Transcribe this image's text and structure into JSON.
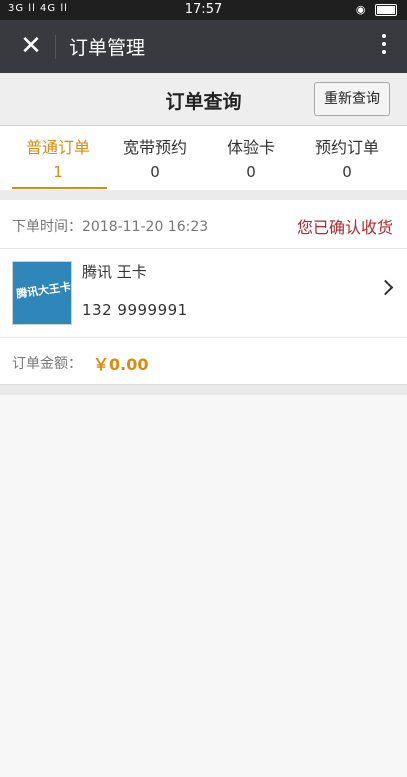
{
  "status_bar": {
    "signal": "3G ll 4G ll",
    "time": "17:57"
  },
  "app_bar": {
    "close_icon": "close-icon",
    "title": "订单管理",
    "more_icon": "more-vertical-icon"
  },
  "header": {
    "title": "订单查询",
    "requery_label": "重新查询"
  },
  "tabs": [
    {
      "label": "普通订单",
      "count": "1",
      "active": true
    },
    {
      "label": "宽带预约",
      "count": "0",
      "active": false
    },
    {
      "label": "体验卡",
      "count": "0",
      "active": false
    },
    {
      "label": "预约订单",
      "count": "0",
      "active": false
    }
  ],
  "order": {
    "time_label": "下单时间：2018-11-20 16:23",
    "status": "您已确认收货",
    "product_image_text": "腾讯大王卡",
    "product_name": "腾讯 王卡",
    "phone": "132 9999991",
    "amount_label": "订单金额：",
    "amount_value": "￥0.00"
  },
  "colors": {
    "accent": "#d98b14",
    "status_red": "#b7262d",
    "app_bar": "#393a3f"
  }
}
